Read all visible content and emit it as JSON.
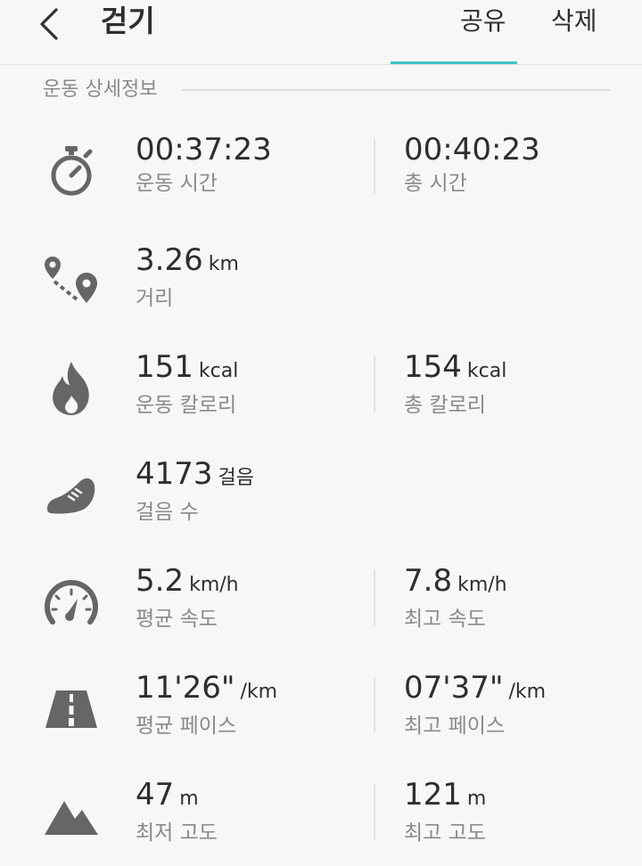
{
  "header": {
    "title": "걷기",
    "share_label": "공유",
    "delete_label": "삭제"
  },
  "section": {
    "title": "운동 상세정보"
  },
  "colors": {
    "accent": "#3fc4c4",
    "icon": "#666666",
    "label": "#8a8a8a"
  },
  "rows": [
    {
      "icon": "stopwatch-icon",
      "left": {
        "value": "00:37:23",
        "unit": "",
        "label": "운동 시간"
      },
      "right": {
        "value": "00:40:23",
        "unit": "",
        "label": "총 시간"
      }
    },
    {
      "icon": "route-icon",
      "left": {
        "value": "3.26",
        "unit": "km",
        "label": "거리"
      }
    },
    {
      "icon": "flame-icon",
      "left": {
        "value": "151",
        "unit": "kcal",
        "label": "운동 칼로리"
      },
      "right": {
        "value": "154",
        "unit": "kcal",
        "label": "총 칼로리"
      }
    },
    {
      "icon": "shoe-icon",
      "left": {
        "value": "4173",
        "unit": "걸음",
        "label": "걸음 수"
      }
    },
    {
      "icon": "speedometer-icon",
      "left": {
        "value": "5.2",
        "unit": "km/h",
        "label": "평균 속도"
      },
      "right": {
        "value": "7.8",
        "unit": "km/h",
        "label": "최고 속도"
      }
    },
    {
      "icon": "road-icon",
      "left": {
        "value": "11'26\"",
        "unit": "/km",
        "label": "평균 페이스"
      },
      "right": {
        "value": "07'37\"",
        "unit": "/km",
        "label": "최고 페이스"
      }
    },
    {
      "icon": "mountain-icon",
      "left": {
        "value": "47",
        "unit": "m",
        "label": "최저 고도"
      },
      "right": {
        "value": "121",
        "unit": "m",
        "label": "최고 고도"
      }
    }
  ]
}
